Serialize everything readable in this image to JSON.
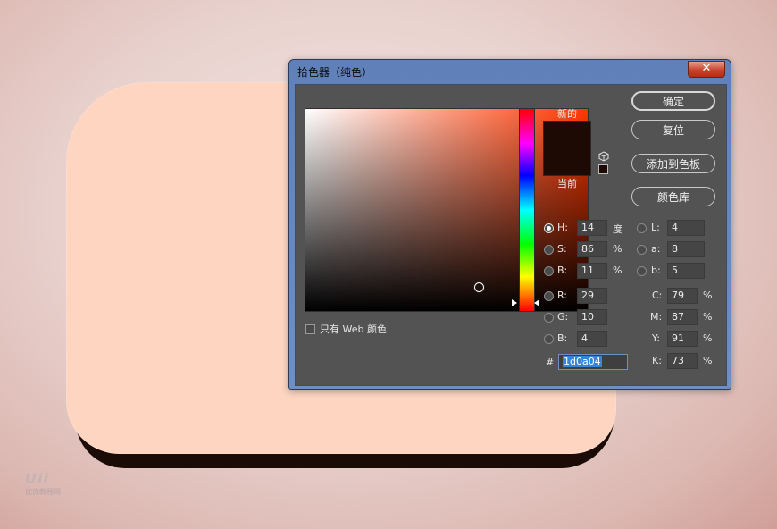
{
  "dialog": {
    "title": "拾色器（纯色）",
    "close_glyph": "✕",
    "new_label": "新的",
    "current_label": "当前",
    "new_color": "#1d0a04",
    "current_color": "#1d0a04",
    "only_web_label": "只有 Web 颜色",
    "only_web_checked": false,
    "buttons": {
      "ok": "确定",
      "reset": "复位",
      "add_swatch": "添加到色板",
      "color_library": "颜色库"
    },
    "hsb": {
      "h_label": "H:",
      "h_value": "14",
      "h_unit": "度",
      "s_label": "S:",
      "s_value": "86",
      "s_unit": "%",
      "b_label": "B:",
      "b_value": "11",
      "b_unit": "%"
    },
    "rgb": {
      "r_label": "R:",
      "r_value": "29",
      "g_label": "G:",
      "g_value": "10",
      "b_label": "B:",
      "b_value": "4"
    },
    "lab": {
      "l_label": "L:",
      "l_value": "4",
      "a_label": "a:",
      "a_value": "8",
      "b_label": "b:",
      "b_value": "5"
    },
    "cmyk": {
      "c_label": "C:",
      "c_value": "79",
      "m_label": "M:",
      "m_value": "87",
      "y_label": "Y:",
      "y_value": "91",
      "k_label": "K:",
      "k_value": "73",
      "unit": "%"
    },
    "hex": {
      "label": "#",
      "value": "1d0a04"
    },
    "selected_mode": "H"
  },
  "canvas": {
    "shape_color": "#fdd5c1",
    "shadow_color": "#1a0b06"
  },
  "watermark": {
    "logo": "Uii",
    "text": "优优教程网"
  }
}
